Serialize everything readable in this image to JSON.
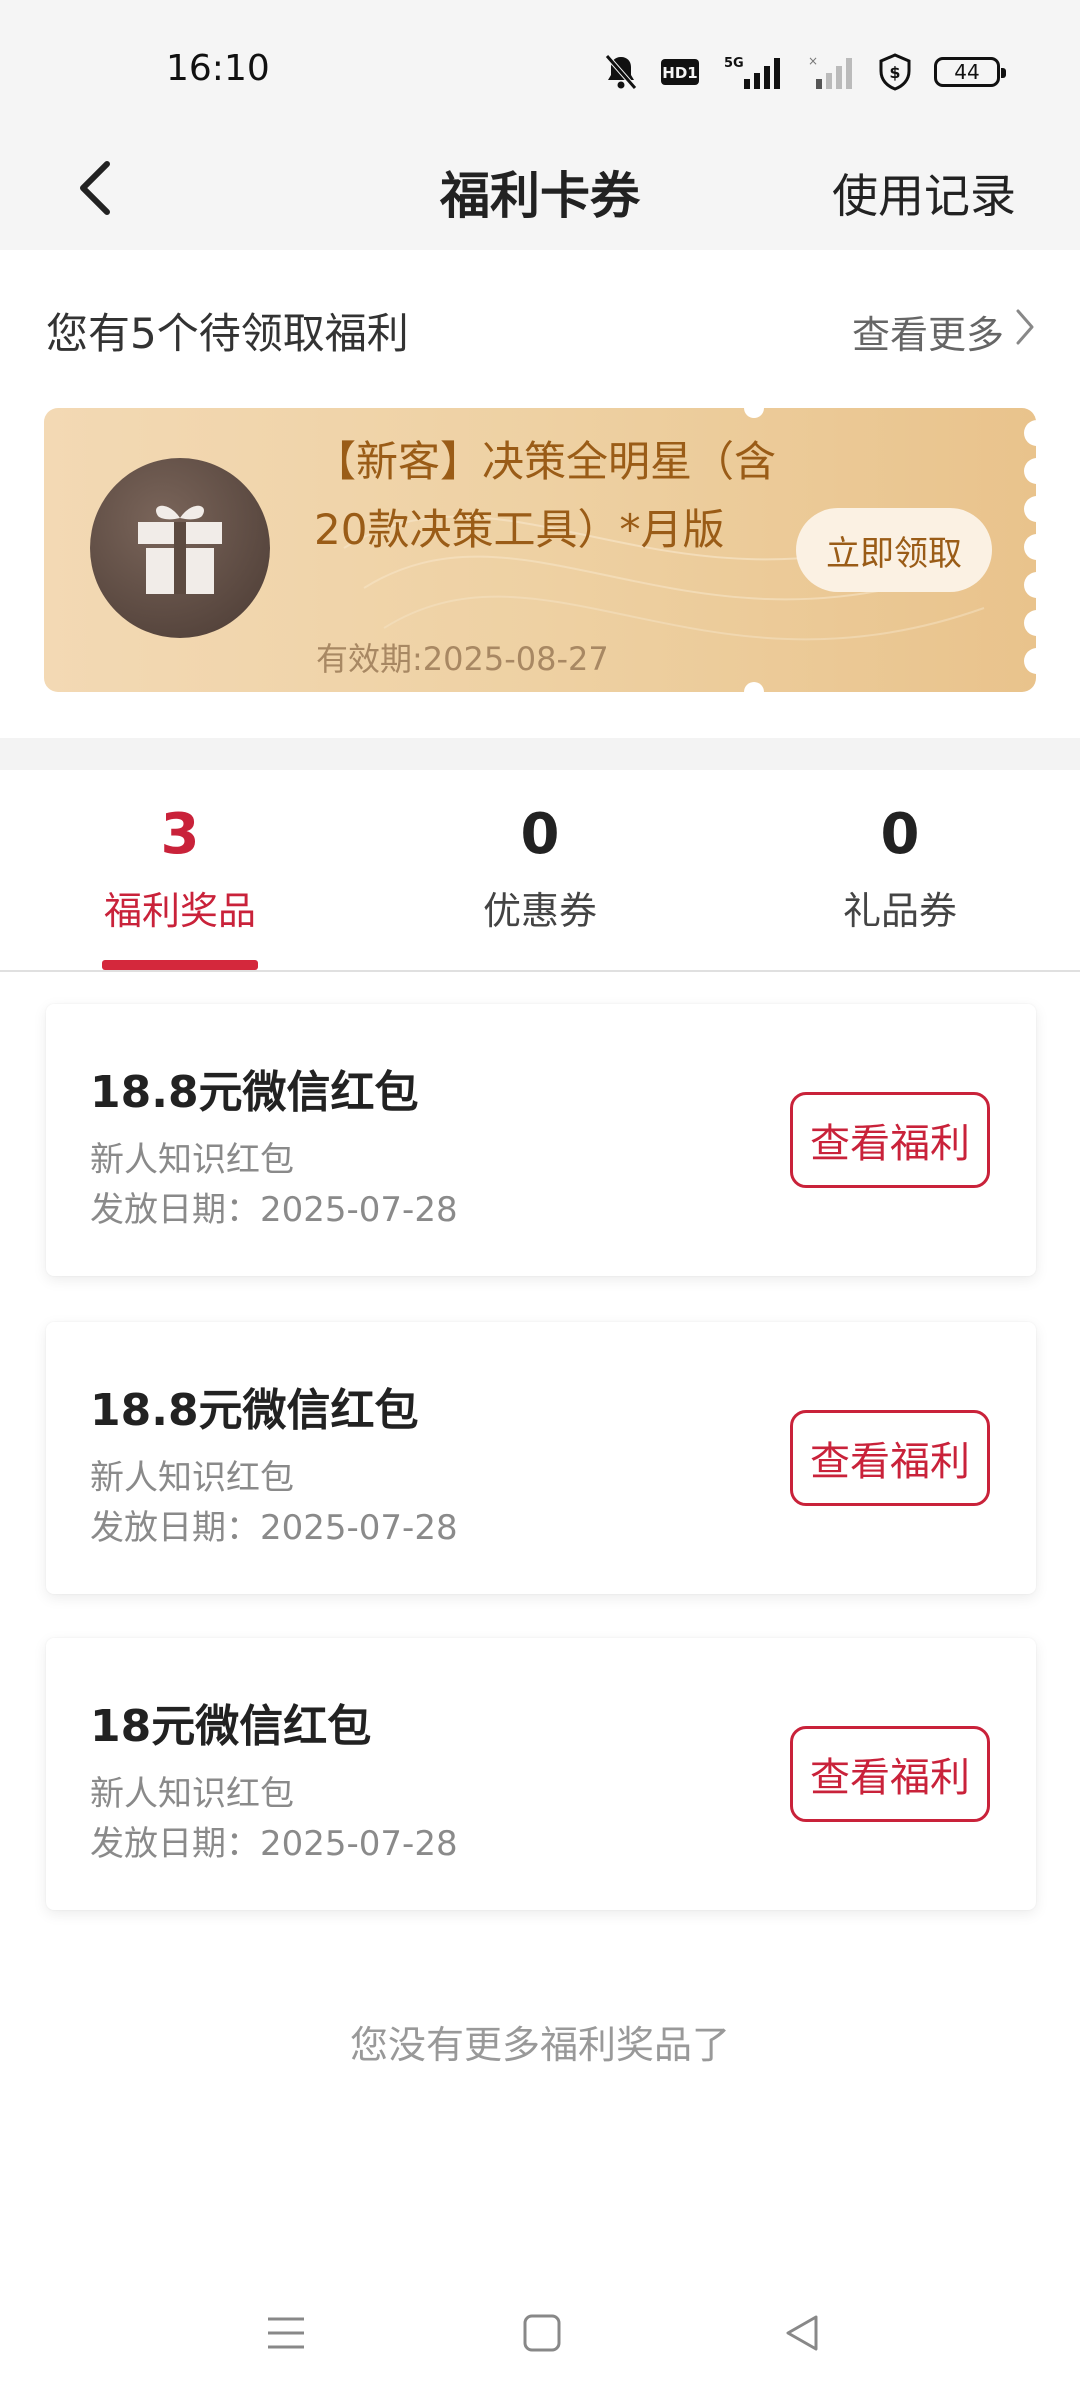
{
  "status_bar": {
    "time": "16:10",
    "battery": "44",
    "network": "5G",
    "hd_badge": "HD1",
    "icons": [
      "mute-bell-icon",
      "hd-icon",
      "signal-5g-icon",
      "signal-weak-icon",
      "shield-dollar-icon",
      "battery-icon"
    ]
  },
  "header": {
    "title": "福利卡券",
    "usage_record": "使用记录",
    "back_icon": "chevron-left-icon"
  },
  "pending": {
    "title": "您有5个待领取福利",
    "view_more": "查看更多"
  },
  "coupon": {
    "title": "【新客】决策全明星（含20款决策工具）*月版",
    "expiry": "有效期:2025-08-27",
    "claim": "立即领取",
    "icon": "gift-icon"
  },
  "tabs": [
    {
      "count": "3",
      "label": "福利奖品",
      "active": true
    },
    {
      "count": "0",
      "label": "优惠券",
      "active": false
    },
    {
      "count": "0",
      "label": "礼品券",
      "active": false
    }
  ],
  "items": [
    {
      "title": "18.8元微信红包",
      "subtitle": "新人知识红包",
      "date": "发放日期：2025-07-28",
      "button": "查看福利"
    },
    {
      "title": "18.8元微信红包",
      "subtitle": "新人知识红包",
      "date": "发放日期：2025-07-28",
      "button": "查看福利"
    },
    {
      "title": "18元微信红包",
      "subtitle": "新人知识红包",
      "date": "发放日期：2025-07-28",
      "button": "查看福利"
    }
  ],
  "end_note": "您没有更多福利奖品了",
  "colors": {
    "accent": "#c9223a",
    "coupon_text": "#9a5c17",
    "coupon_bg": "#eed1a3"
  }
}
